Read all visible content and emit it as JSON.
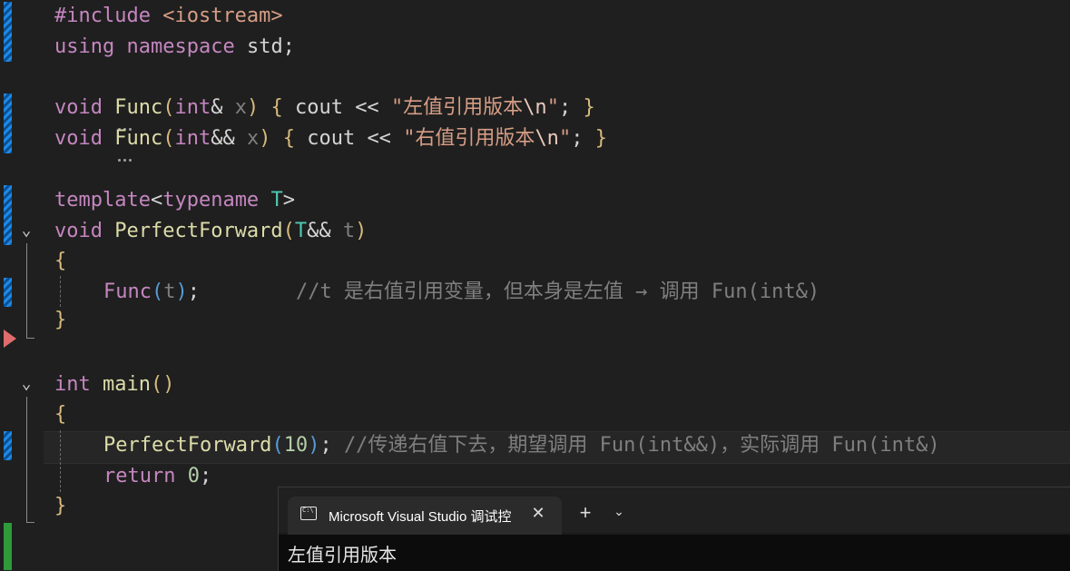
{
  "editor": {
    "lines": {
      "l1": {
        "kw": "#include",
        "rest": " <iostream>"
      },
      "l2": {
        "kw": "using",
        "kw2": "namespace",
        "rest": " std;"
      },
      "l4": {
        "ret": "void",
        "fn": "Func",
        "p1": "(",
        "ty": "int",
        "amp": "& ",
        "var": "x",
        "p2": ")",
        "sp": " ",
        "b1": "{",
        "body": " cout << ",
        "str1": "\"左值引用版本",
        "esc": "\\n",
        "str2": "\"",
        "semi": "; ",
        "b2": "}"
      },
      "l5": {
        "ret": "void",
        "fn": "Func",
        "p1": "(",
        "ty": "int",
        "amp": "&& ",
        "var": "x",
        "p2": ")",
        "sp": " ",
        "b1": "{",
        "body": " cout << ",
        "str1": "\"右值引用版本",
        "esc": "\\n",
        "str2": "\"",
        "semi": "; ",
        "b2": "}"
      },
      "l7": {
        "kw": "template",
        "lt": "<",
        "kw2": "typename",
        "sp": " ",
        "tp": "T",
        "gt": ">"
      },
      "l8": {
        "ret": "void",
        "fn": "PerfectForward",
        "p1": "(",
        "tp": "T",
        "amp": "&& ",
        "var": "t",
        "p2": ")"
      },
      "l9": {
        "b": "{"
      },
      "l10": {
        "fn": "Func",
        "p1": "(",
        "var": "t",
        "p2": ")",
        "semi": ";",
        "gap": "        ",
        "cm": "//t 是右值引用变量，但本身是左值 → 调用 Fun(int&)"
      },
      "l11": {
        "b": "}"
      },
      "l13": {
        "ty": "int",
        "sp": " ",
        "fn": "main",
        "par": "()"
      },
      "l14": {
        "b": "{"
      },
      "l15": {
        "fn": "PerfectForward",
        "p1": "(",
        "num": "10",
        "p2": ")",
        "semi": "; ",
        "cm": "//传递右值下去，期望调用 Fun(int&&)，实际调用 Fun(int&)"
      },
      "l16": {
        "kw": "return",
        "sp": " ",
        "num": "0",
        "semi": ";"
      },
      "l17": {
        "b": "}"
      }
    },
    "fold_glyph": "⌄"
  },
  "console": {
    "tab_title": "Microsoft Visual Studio 调试控",
    "close_glyph": "✕",
    "new_tab_glyph": "+",
    "dropdown_glyph": "⌄",
    "output": "左值引用版本"
  },
  "colors": {
    "background": "#1f1f1f",
    "keyword": "#c586c0",
    "function": "#dcdcaa",
    "type": "#569cd6",
    "template_param": "#4ec9b0",
    "comment": "#7f7f7f",
    "change_mark_blue": "#1e88e5",
    "change_mark_green": "#2e9a3a",
    "breakpoint_arrow": "#e06c6c"
  }
}
